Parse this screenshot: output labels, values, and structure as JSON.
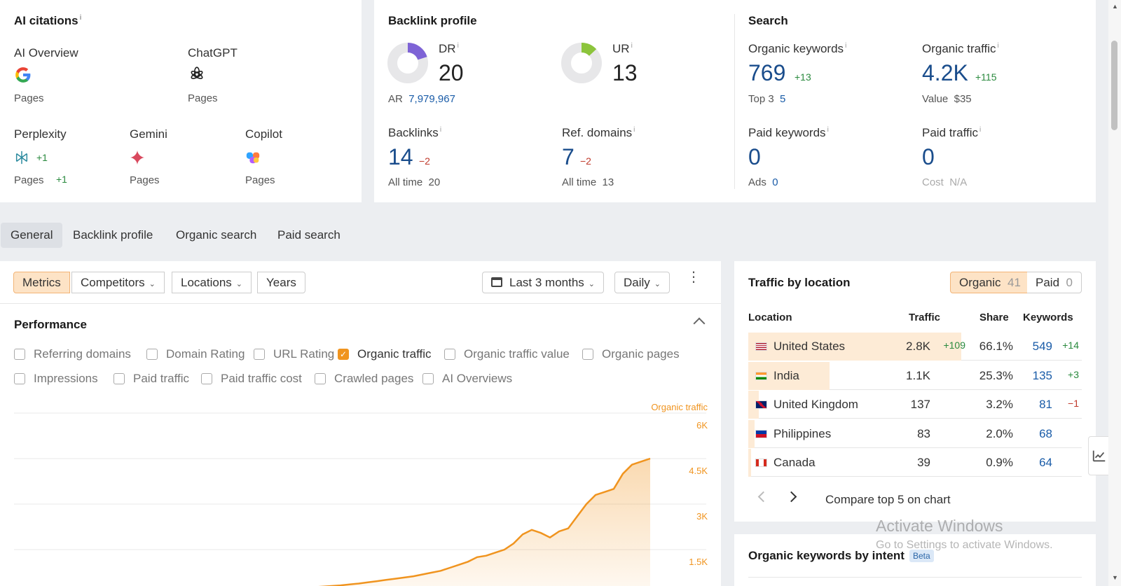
{
  "ai_citations": {
    "title": "AI citations",
    "info": "i",
    "ai_overview": {
      "name": "AI Overview",
      "sub": "Pages"
    },
    "chatgpt": {
      "name": "ChatGPT",
      "sub": "Pages"
    },
    "perplexity": {
      "name": "Perplexity",
      "delta": "+1",
      "sub": "Pages",
      "sub_delta": "+1"
    },
    "gemini": {
      "name": "Gemini",
      "sub": "Pages"
    },
    "copilot": {
      "name": "Copilot",
      "sub": "Pages"
    }
  },
  "backlink_profile": {
    "title": "Backlink profile",
    "dr": {
      "label": "DR",
      "value": "20",
      "fill_percent": 20
    },
    "ar": {
      "label": "AR",
      "value": "7,979,967"
    },
    "ur": {
      "label": "UR",
      "value": "13",
      "fill_percent": 13
    },
    "backlinks": {
      "label": "Backlinks",
      "value": "14",
      "delta": "−2",
      "all_time_label": "All time",
      "all_time": "20"
    },
    "ref_domains": {
      "label": "Ref. domains",
      "value": "7",
      "delta": "−2",
      "all_time_label": "All time",
      "all_time": "13"
    }
  },
  "search": {
    "title": "Search",
    "organic_keywords": {
      "label": "Organic keywords",
      "value": "769",
      "delta": "+13",
      "top3_label": "Top 3",
      "top3": "5"
    },
    "organic_traffic": {
      "label": "Organic traffic",
      "value": "4.2K",
      "delta": "+115",
      "value_label": "Value",
      "value_amount": "$35"
    },
    "paid_keywords": {
      "label": "Paid keywords",
      "value": "0",
      "ads_label": "Ads",
      "ads": "0"
    },
    "paid_traffic": {
      "label": "Paid traffic",
      "value": "0",
      "cost_label": "Cost",
      "cost": "N/A"
    }
  },
  "tabs": [
    "General",
    "Backlink profile",
    "Organic search",
    "Paid search"
  ],
  "toolbar": {
    "metrics": "Metrics",
    "competitors": "Competitors",
    "locations": "Locations",
    "years": "Years",
    "range": "Last 3 months",
    "interval": "Daily"
  },
  "performance": {
    "title": "Performance",
    "checkboxes": [
      {
        "label": "Referring domains",
        "checked": false
      },
      {
        "label": "Domain Rating",
        "checked": false
      },
      {
        "label": "URL Rating",
        "checked": false
      },
      {
        "label": "Organic traffic",
        "checked": true
      },
      {
        "label": "Organic traffic value",
        "checked": false
      },
      {
        "label": "Organic pages",
        "checked": false
      },
      {
        "label": "Impressions",
        "checked": false
      },
      {
        "label": "Paid traffic",
        "checked": false
      },
      {
        "label": "Paid traffic cost",
        "checked": false
      },
      {
        "label": "Crawled pages",
        "checked": false
      },
      {
        "label": "AI Overviews",
        "checked": false
      }
    ]
  },
  "chart_data": {
    "type": "area",
    "series": [
      {
        "name": "Organic traffic",
        "values": [
          0,
          20,
          50,
          80,
          100,
          110,
          120,
          130,
          140,
          150,
          160,
          170,
          180,
          190,
          200,
          210,
          220,
          230,
          240,
          260,
          280,
          300,
          320,
          350,
          380,
          420,
          460,
          500,
          540,
          580,
          620,
          680,
          740,
          800,
          900,
          1000,
          1100,
          1250,
          1300,
          1400,
          1500,
          1700,
          2000,
          2150,
          2050,
          1900,
          2100,
          2200,
          2600,
          3000,
          3300,
          3400,
          3500,
          4000,
          4300,
          4400,
          4500
        ]
      }
    ],
    "yticks": [
      "1.5K",
      "3K",
      "4.5K",
      "6K"
    ],
    "ylim": [
      0,
      6000
    ],
    "color": "#f0941f"
  },
  "traffic_by_location": {
    "title": "Traffic by location",
    "organic_label": "Organic",
    "organic_count": "41",
    "paid_label": "Paid",
    "paid_count": "0",
    "headers": [
      "Location",
      "Traffic",
      "Share",
      "Keywords"
    ],
    "rows": [
      {
        "country": "United States",
        "traffic": "2.8K",
        "traffic_delta": "+109",
        "share": "66.1%",
        "share_value": 66.1,
        "keywords": "549",
        "kw_delta": "+14",
        "kw_delta_type": "pos"
      },
      {
        "country": "India",
        "traffic": "1.1K",
        "traffic_delta": "",
        "share": "25.3%",
        "share_value": 25.3,
        "keywords": "135",
        "kw_delta": "+3",
        "kw_delta_type": "pos"
      },
      {
        "country": "United Kingdom",
        "traffic": "137",
        "traffic_delta": "",
        "share": "3.2%",
        "share_value": 3.2,
        "keywords": "81",
        "kw_delta": "−1",
        "kw_delta_type": "neg"
      },
      {
        "country": "Philippines",
        "traffic": "83",
        "traffic_delta": "",
        "share": "2.0%",
        "share_value": 2.0,
        "keywords": "68",
        "kw_delta": "",
        "kw_delta_type": ""
      },
      {
        "country": "Canada",
        "traffic": "39",
        "traffic_delta": "",
        "share": "0.9%",
        "share_value": 0.9,
        "keywords": "64",
        "kw_delta": "",
        "kw_delta_type": ""
      }
    ],
    "compare": "Compare top 5 on chart"
  },
  "organic_by_intent": {
    "title": "Organic keywords by intent",
    "badge": "Beta"
  },
  "watermark": {
    "line1": "Activate Windows",
    "line2": "Go to Settings to activate Windows."
  }
}
